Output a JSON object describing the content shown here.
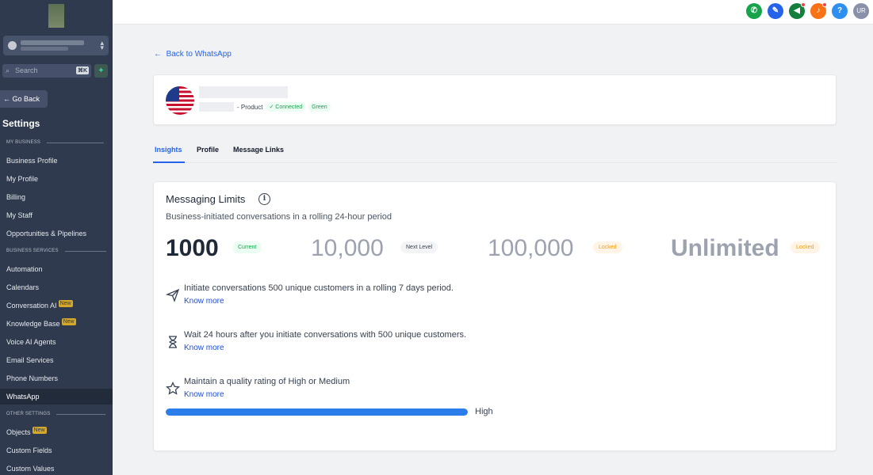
{
  "sidebar": {
    "search_placeholder": "Search",
    "search_shortcut": "⌘K",
    "go_back": "Go Back",
    "title": "Settings",
    "sections": {
      "my_business": "MY BUSINESS",
      "business_services": "BUSINESS SERVICES",
      "other_settings": "OTHER SETTINGS"
    },
    "items": {
      "business_profile": "Business Profile",
      "my_profile": "My Profile",
      "billing": "Billing",
      "my_staff": "My Staff",
      "opportunities": "Opportunities & Pipelines",
      "automation": "Automation",
      "calendars": "Calendars",
      "conversation_ai": "Conversation AI",
      "knowledge_base": "Knowledge Base",
      "voice_ai": "Voice AI Agents",
      "email_services": "Email Services",
      "phone_numbers": "Phone Numbers",
      "whatsapp": "WhatsApp",
      "objects": "Objects",
      "custom_fields": "Custom Fields",
      "custom_values": "Custom Values"
    },
    "new_badge": "New"
  },
  "topbar": {
    "avatar_initials": "UR",
    "icons": [
      "phone-icon",
      "ticket-icon",
      "megaphone-icon",
      "bell-icon",
      "help-icon"
    ],
    "colors": [
      "#16a34a",
      "#2563eb",
      "#15803d",
      "#f97316",
      "#2f8ff0"
    ]
  },
  "main": {
    "back_link": "Back to WhatsApp",
    "account": {
      "product_text": "- Product",
      "connected": "Connected",
      "quality": "Green"
    },
    "tabs": [
      "Insights",
      "Profile",
      "Message Links"
    ],
    "messaging": {
      "title": "Messaging Limits",
      "subtitle": "Business-initiated conversations in a rolling 24-hour period",
      "levels": [
        {
          "value": "1000",
          "badge": "Current"
        },
        {
          "value": "10,000",
          "badge": "Next Level"
        },
        {
          "value": "100,000",
          "badge": "Locked"
        },
        {
          "value": "Unlimited",
          "badge": "Locked"
        }
      ],
      "requirements": [
        {
          "text": "Initiate conversations 500 unique customers in a rolling 7 days period.",
          "link": "Know more",
          "icon": "send-icon"
        },
        {
          "text": "Wait 24 hours after you initiate conversations with 500 unique customers.",
          "link": "Know more",
          "icon": "hourglass-icon"
        },
        {
          "text": "Maintain a quality rating of High or Medium",
          "link": "Know more",
          "icon": "star-icon"
        }
      ],
      "quality_label": "High",
      "quality_fraction": 1.0
    }
  }
}
